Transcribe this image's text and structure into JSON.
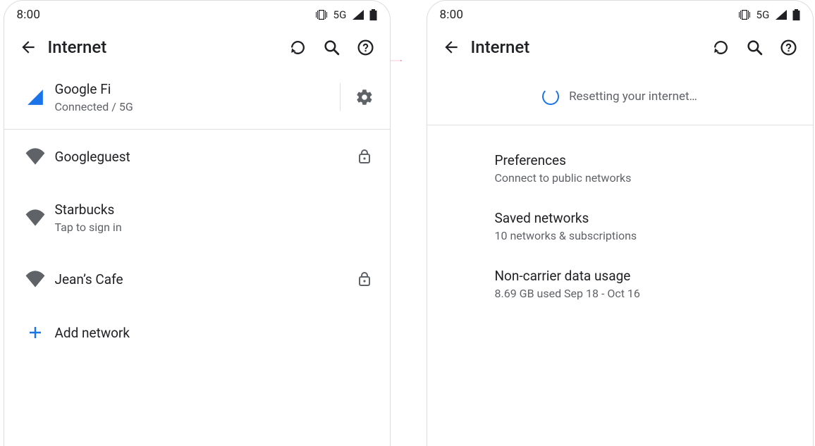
{
  "status": {
    "time": "8:00",
    "net_label": "5G"
  },
  "appbar": {
    "title": "Internet"
  },
  "carrier": {
    "name": "Google Fi",
    "status": "Connected / 5G"
  },
  "networks": [
    {
      "name": "Googleguest",
      "sub": "",
      "locked": true
    },
    {
      "name": "Starbucks",
      "sub": "Tap to sign in",
      "locked": false
    },
    {
      "name": "Jean’s Cafe",
      "sub": "",
      "locked": true
    }
  ],
  "add_network": "Add network",
  "resetting": "Resetting your internet…",
  "prefs": [
    {
      "name": "Preferences",
      "sub": "Connect to public networks"
    },
    {
      "name": "Saved networks",
      "sub": "10 networks & subscriptions"
    },
    {
      "name": "Non-carrier data usage",
      "sub": "8.69 GB used Sep 18 - Oct 16"
    }
  ]
}
